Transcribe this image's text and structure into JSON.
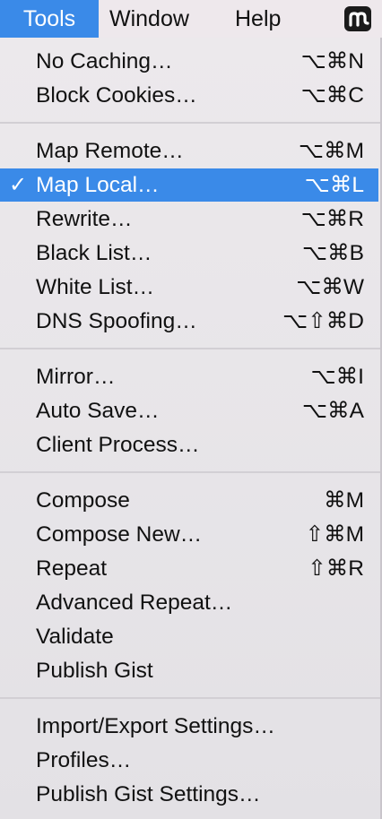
{
  "menubar": {
    "tools": "Tools",
    "window": "Window",
    "help": "Help",
    "app_icon": "m-logo-icon"
  },
  "menu": {
    "check_mark": "✓",
    "items": [
      {
        "label": "No Caching…",
        "shortcut": "⌥⌘N"
      },
      {
        "label": "Block Cookies…",
        "shortcut": "⌥⌘C"
      },
      {
        "label": "Map Remote…",
        "shortcut": "⌥⌘M"
      },
      {
        "label": "Map Local…",
        "shortcut": "⌥⌘L",
        "checked": true,
        "highlighted": true
      },
      {
        "label": "Rewrite…",
        "shortcut": "⌥⌘R"
      },
      {
        "label": "Black List…",
        "shortcut": "⌥⌘B"
      },
      {
        "label": "White List…",
        "shortcut": "⌥⌘W"
      },
      {
        "label": "DNS Spoofing…",
        "shortcut": "⌥⇧⌘D"
      },
      {
        "label": "Mirror…",
        "shortcut": "⌥⌘I"
      },
      {
        "label": "Auto Save…",
        "shortcut": "⌥⌘A"
      },
      {
        "label": "Client Process…",
        "shortcut": ""
      },
      {
        "label": "Compose",
        "shortcut": "⌘M"
      },
      {
        "label": "Compose New…",
        "shortcut": "⇧⌘M"
      },
      {
        "label": "Repeat",
        "shortcut": "⇧⌘R"
      },
      {
        "label": "Advanced Repeat…",
        "shortcut": ""
      },
      {
        "label": "Validate",
        "shortcut": ""
      },
      {
        "label": "Publish Gist",
        "shortcut": ""
      },
      {
        "label": "Import/Export Settings…",
        "shortcut": ""
      },
      {
        "label": "Profiles…",
        "shortcut": ""
      },
      {
        "label": "Publish Gist Settings…",
        "shortcut": ""
      }
    ]
  }
}
